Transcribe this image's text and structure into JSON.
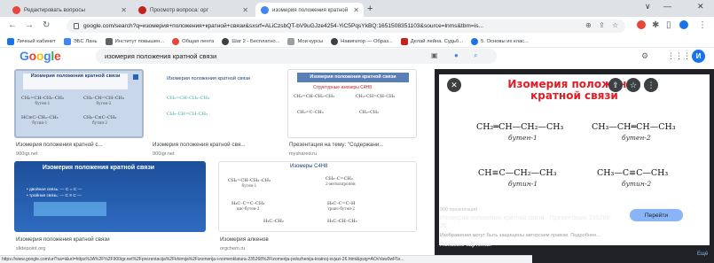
{
  "tabs": [
    {
      "label": "Редактировать вопросы",
      "favicon_color": "#e8453c"
    },
    {
      "label": "Просмотр вопроса: орг",
      "favicon_color": "#c5221f"
    },
    {
      "label": "изомерия положения кратной",
      "favicon_color": "#4285f4"
    }
  ],
  "window": {
    "minimize": "∨",
    "restore": "—",
    "close": "✕",
    "new_tab": "+"
  },
  "address_bar": {
    "url": "google.com/search?q=изомерия+положения+кратной+связи&sxsrf=ALiCzsbQT-bV9uGJze4254-YiC5PqsYkBQ:1651508351103&source=lnms&tbm=is..."
  },
  "bookmarks": [
    {
      "label": "Личный кабинет",
      "color": "#1a73e8"
    },
    {
      "label": "ЭБС Лань",
      "color": "#4285f4"
    },
    {
      "label": "Институт повышен...",
      "color": "#5f6368"
    },
    {
      "label": "Общая лента",
      "color": "#e8453c"
    },
    {
      "label": "Шаг 2 - Бесплатно...",
      "color": "#3c4043"
    },
    {
      "label": "Мои курсы",
      "color": "#9aa0a6"
    },
    {
      "label": "Навигатор — Образ...",
      "color": "#3c4043"
    },
    {
      "label": "Делай лейна. Судьб...",
      "color": "#c5221f"
    },
    {
      "label": "5. Основы их клас...",
      "color": "#1a73e8"
    }
  ],
  "google": {
    "logo": "Google",
    "query": "изомерия положения кратной связи"
  },
  "results": [
    {
      "caption": "Изомерия положения кратной с...",
      "source": "900igr.net"
    },
    {
      "caption": "Изомерия положения кратной свя...",
      "source": "900igr.net"
    },
    {
      "caption": "Презентация на тему: \"Содержани...",
      "source": "myshared.ru"
    },
    {
      "caption": "Изомерия положения кратной связи",
      "source": "slidepoint.org"
    },
    {
      "caption": "Изомерия алкенов",
      "source": "orgchem.ru"
    }
  ],
  "thumbs": {
    "t1_title": "Изомерия положения кратной связи",
    "t2_title": "Изомерия положения кратной связи",
    "t3_title": "Изомерия положения кратной связи",
    "t3_subtitle": "Структурные изомеры C4H8",
    "t4_title": "Изомерия положения кратной связи",
    "t4_lines": [
      "• двойная связь: — C = C —",
      "• тройная связь: — C ≡ C —"
    ],
    "t5_title": "Изомеры C4H8"
  },
  "preview": {
    "title_line1": "Изомерия положения",
    "title_line2": "кратной связи",
    "formulas": [
      {
        "formula": "CH₂═CH—CH₂—CH₃",
        "name": "бутен-1"
      },
      {
        "formula": "CH₃—CH═CH—CH₃",
        "name": "бутен-2"
      },
      {
        "formula": "CH≡C—CH₂—CH₃",
        "name": "бутин-1"
      },
      {
        "formula": "CH₃—C≡C—CH₃",
        "name": "бутин-2"
      }
    ],
    "site": "900 презентаций",
    "result_title": "Изомерия положения кратной связи - Презентация 235268-26",
    "copyright": "Изображения могут быть защищены авторским правом. Подробнее...",
    "visit_label": "Перейти",
    "related": "Похожие картинки",
    "more": "Ещё"
  },
  "status_url": "https://www.google.com/url?sa=i&url=https%3A%2F%2F900igr.net%2Fprezentacija%2Fkhimija%2Fizomerija-i-nomenklatura-235268%2Fizomerija-polozhenija-kratnoj-svjazi-26.html&psig=AOvVaw0wF5x..."
}
